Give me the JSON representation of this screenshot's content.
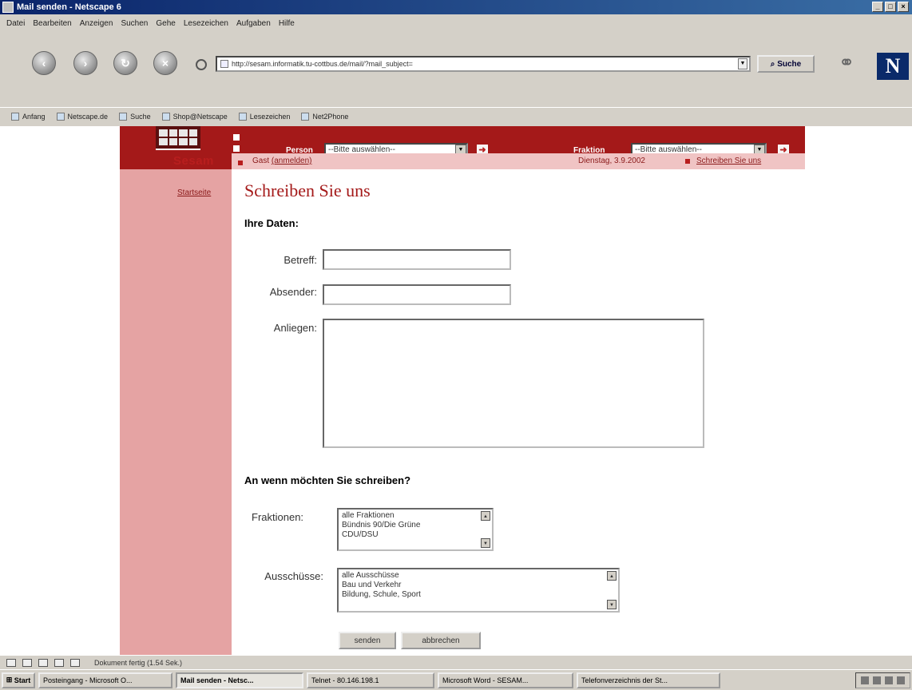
{
  "window": {
    "title": "Mail senden - Netscape 6"
  },
  "menu": [
    "Datei",
    "Bearbeiten",
    "Anzeigen",
    "Suchen",
    "Gehe",
    "Lesezeichen",
    "Aufgaben",
    "Hilfe"
  ],
  "toolbar": {
    "url": "http://sesam.informatik.tu-cottbus.de/mail/?mail_subject=",
    "search_label": "Suche"
  },
  "personal_bar": [
    "Anfang",
    "Netscape.de",
    "Suche",
    "Shop@Netscape",
    "Lesezeichen",
    "Net2Phone"
  ],
  "header": {
    "person_label": "Person",
    "person_select": "--Bitte auswählen--",
    "fraktion_label": "Fraktion",
    "fraktion_select": "--Bitte auswählen--"
  },
  "brand": "Sesam",
  "guest": {
    "prefix": "Gast",
    "login_link": "(anmelden)"
  },
  "date": "Dienstag, 3.9.2002",
  "contact_link": "Schreiben Sie uns",
  "sidebar": {
    "startseite": "Startseite"
  },
  "form": {
    "title": "Schreiben Sie uns",
    "section_data": "Ihre Daten:",
    "betreff_label": "Betreff:",
    "absender_label": "Absender:",
    "anliegen_label": "Anliegen:",
    "section_recipient": "An wenn möchten Sie schreiben?",
    "fraktionen_label": "Fraktionen:",
    "fraktionen_options": [
      "alle Fraktionen",
      "Bündnis 90/Die Grüne",
      "CDU/DSU"
    ],
    "ausschuesse_label": "Ausschüsse:",
    "ausschuesse_options": [
      "alle Ausschüsse",
      "Bau und Verkehr",
      "Bildung, Schule, Sport"
    ],
    "send_label": "senden",
    "cancel_label": "abbrechen"
  },
  "status": {
    "text": "Dokument fertig (1.54 Sek.)"
  },
  "taskbar": {
    "start": "Start",
    "tasks": [
      "Posteingang - Microsoft O...",
      "Mail senden - Netsc...",
      "Telnet - 80.146.198.1",
      "Microsoft Word - SESAM...",
      "Telefonverzeichnis der St..."
    ]
  },
  "colors": {
    "brand_red": "#b81e1e",
    "sidebar_pink": "#e5a3a3",
    "bar_pink": "#f0c4c4"
  }
}
